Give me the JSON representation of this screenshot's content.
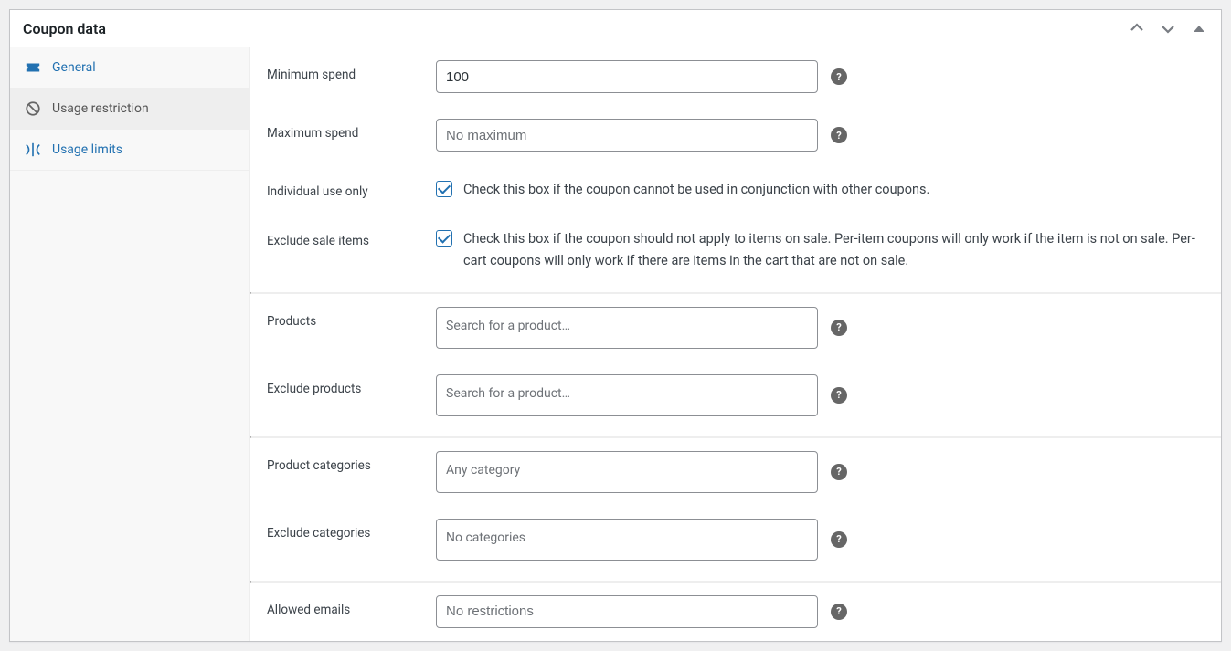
{
  "panel": {
    "title": "Coupon data"
  },
  "sidebar": {
    "items": [
      {
        "label": "General"
      },
      {
        "label": "Usage restriction"
      },
      {
        "label": "Usage limits"
      }
    ]
  },
  "fields": {
    "minimum_spend": {
      "label": "Minimum spend",
      "value": "100"
    },
    "maximum_spend": {
      "label": "Maximum spend",
      "placeholder": "No maximum"
    },
    "individual_use": {
      "label": "Individual use only",
      "checked": true,
      "description": "Check this box if the coupon cannot be used in conjunction with other coupons."
    },
    "exclude_sale": {
      "label": "Exclude sale items",
      "checked": true,
      "description": "Check this box if the coupon should not apply to items on sale. Per-item coupons will only work if the item is not on sale. Per-cart coupons will only work if there are items in the cart that are not on sale."
    },
    "products": {
      "label": "Products",
      "placeholder": "Search for a product…"
    },
    "exclude_products": {
      "label": "Exclude products",
      "placeholder": "Search for a product…"
    },
    "product_categories": {
      "label": "Product categories",
      "placeholder": "Any category"
    },
    "exclude_categories": {
      "label": "Exclude categories",
      "placeholder": "No categories"
    },
    "allowed_emails": {
      "label": "Allowed emails",
      "placeholder": "No restrictions"
    }
  }
}
